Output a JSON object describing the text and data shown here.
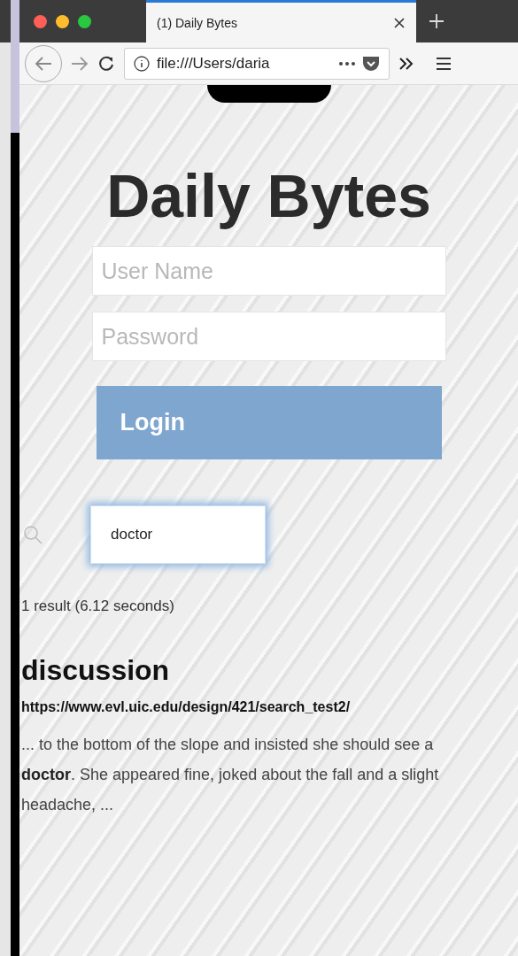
{
  "browser": {
    "tab_title": "(1) Daily Bytes",
    "address": "file:///Users/daria"
  },
  "page": {
    "title": "Daily Bytes",
    "login": {
      "username": {
        "placeholder": "User Name"
      },
      "password": {
        "placeholder": "Password"
      },
      "button": "Login"
    },
    "search": {
      "value": "doctor"
    },
    "result_count": "1 result (6.12 seconds)",
    "results": [
      {
        "title": "discussion",
        "url": "https://www.evl.uic.edu/design/421/search_test2/",
        "snippet": "... to the bottom of the slope and insisted she should see a **doctor**. She appeared fine, joked about the fall and a slight headache, ..."
      }
    ]
  }
}
